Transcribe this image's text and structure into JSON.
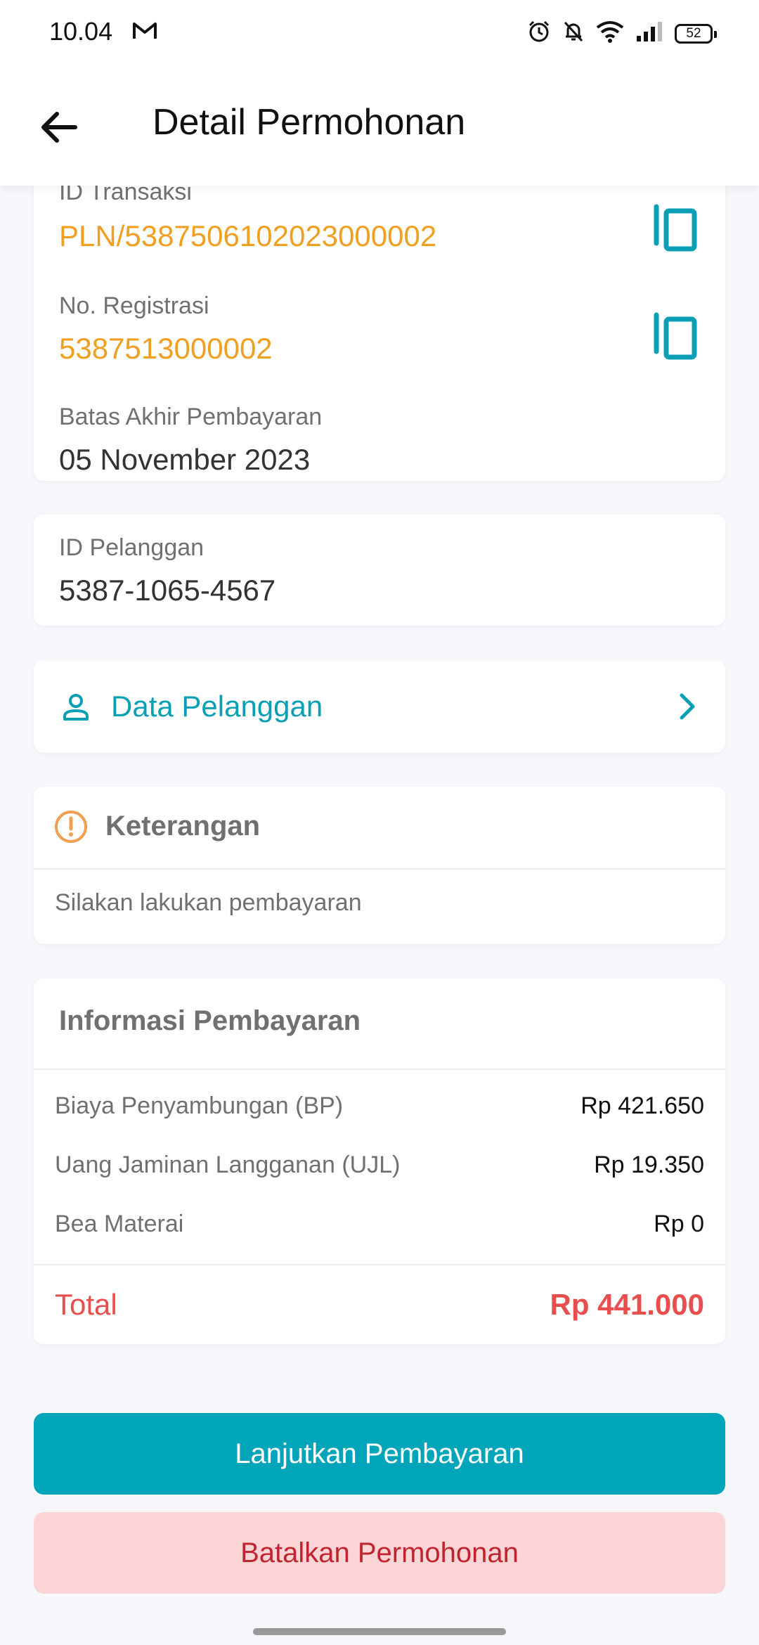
{
  "status_bar": {
    "time": "10.04",
    "battery": "52"
  },
  "app_bar": {
    "title": "Detail Permohonan"
  },
  "transaction": {
    "id_label": "ID Transaksi",
    "id_value": "PLN/5387506102023000002",
    "reg_label": "No. Registrasi",
    "reg_value": "5387513000002",
    "due_label": "Batas Akhir Pembayaran",
    "due_value": "05 November 2023"
  },
  "customer": {
    "id_label": "ID Pelanggan",
    "id_value": "5387-1065-4567",
    "data_label": "Data Pelanggan"
  },
  "note": {
    "title": "Keterangan",
    "text": "Silakan lakukan pembayaran"
  },
  "payment": {
    "title": "Informasi Pembayaran",
    "items": [
      {
        "label": "Biaya Penyambungan (BP)",
        "value": "Rp 421.650"
      },
      {
        "label": "Uang Jaminan Langganan (UJL)",
        "value": "Rp 19.350"
      },
      {
        "label": "Bea Materai",
        "value": "Rp 0"
      }
    ],
    "total_label": "Total",
    "total_value": "Rp 441.000"
  },
  "actions": {
    "continue_label": "Lanjutkan Pembayaran",
    "cancel_label": "Batalkan Permohonan"
  },
  "colors": {
    "accent": "#00a5ba",
    "orange": "#f0a020",
    "danger": "#e84e4e",
    "danger_bg": "#fbd5d5"
  }
}
